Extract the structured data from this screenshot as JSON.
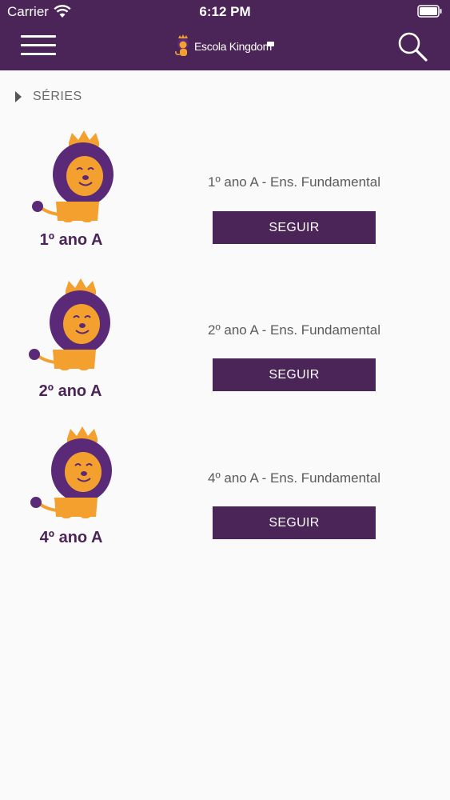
{
  "status_bar": {
    "carrier": "Carrier",
    "time": "6:12 PM"
  },
  "header": {
    "logo_text": "Escola Kingdom",
    "menu_icon": "hamburger-menu-icon",
    "search_icon": "search-icon",
    "background_color": "#4b2557"
  },
  "breadcrumb": {
    "label": "SÉRIES"
  },
  "colors": {
    "accent": "#4b2557",
    "lion_mane": "#5a2a78",
    "lion_body": "#f3a02e",
    "crown": "#f3a02e"
  },
  "series": [
    {
      "image_label": "1º ano A",
      "title": "1º ano A - Ens. Fundamental",
      "button_label": "SEGUIR"
    },
    {
      "image_label": "2º ano A",
      "title": "2º ano A - Ens. Fundamental",
      "button_label": "SEGUIR"
    },
    {
      "image_label": "4º ano A",
      "title": "4º ano A - Ens. Fundamental",
      "button_label": "SEGUIR"
    }
  ]
}
